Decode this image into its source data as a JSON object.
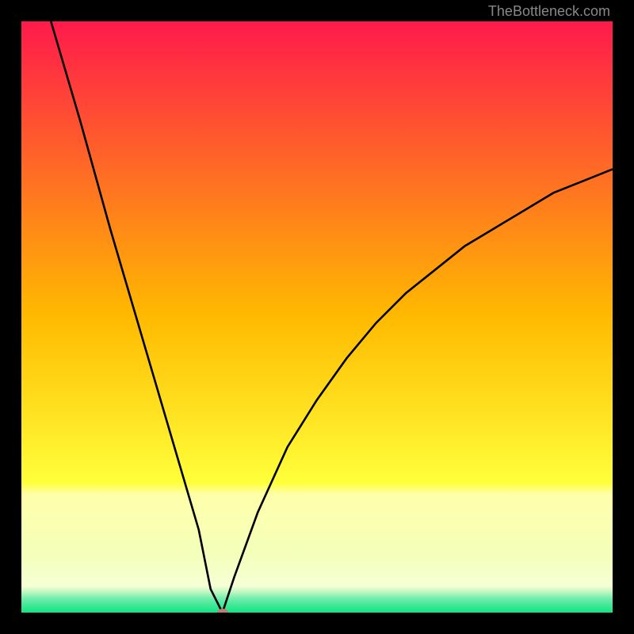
{
  "watermark": "TheBottleneck.com",
  "chart_data": {
    "type": "line",
    "title": "",
    "xlabel": "",
    "ylabel": "",
    "xlim": [
      0,
      100
    ],
    "ylim": [
      0,
      100
    ],
    "minimum_x": 34,
    "series": [
      {
        "name": "bottleneck-curve",
        "x": [
          5,
          10,
          15,
          20,
          25,
          30,
          32,
          34,
          36,
          40,
          45,
          50,
          55,
          60,
          65,
          70,
          75,
          80,
          85,
          90,
          95,
          100
        ],
        "y": [
          100,
          83,
          65,
          48,
          31,
          14,
          4,
          0,
          6,
          17,
          28,
          36,
          43,
          49,
          54,
          58,
          62,
          65,
          68,
          71,
          73,
          75
        ]
      }
    ],
    "marker": {
      "x": 34,
      "y": 0
    },
    "gradient_stops": [
      {
        "pos": 0.0,
        "color": "#ff1a4b"
      },
      {
        "pos": 0.5,
        "color": "#ffba00"
      },
      {
        "pos": 0.78,
        "color": "#ffff3a"
      },
      {
        "pos": 0.8,
        "color": "#ffffaa"
      },
      {
        "pos": 0.9,
        "color": "#f4ffba"
      },
      {
        "pos": 0.955,
        "color": "#f5ffd5"
      },
      {
        "pos": 0.965,
        "color": "#c0f7c0"
      },
      {
        "pos": 0.975,
        "color": "#7aeeb0"
      },
      {
        "pos": 0.985,
        "color": "#4be89a"
      },
      {
        "pos": 1.0,
        "color": "#10e683"
      }
    ]
  }
}
